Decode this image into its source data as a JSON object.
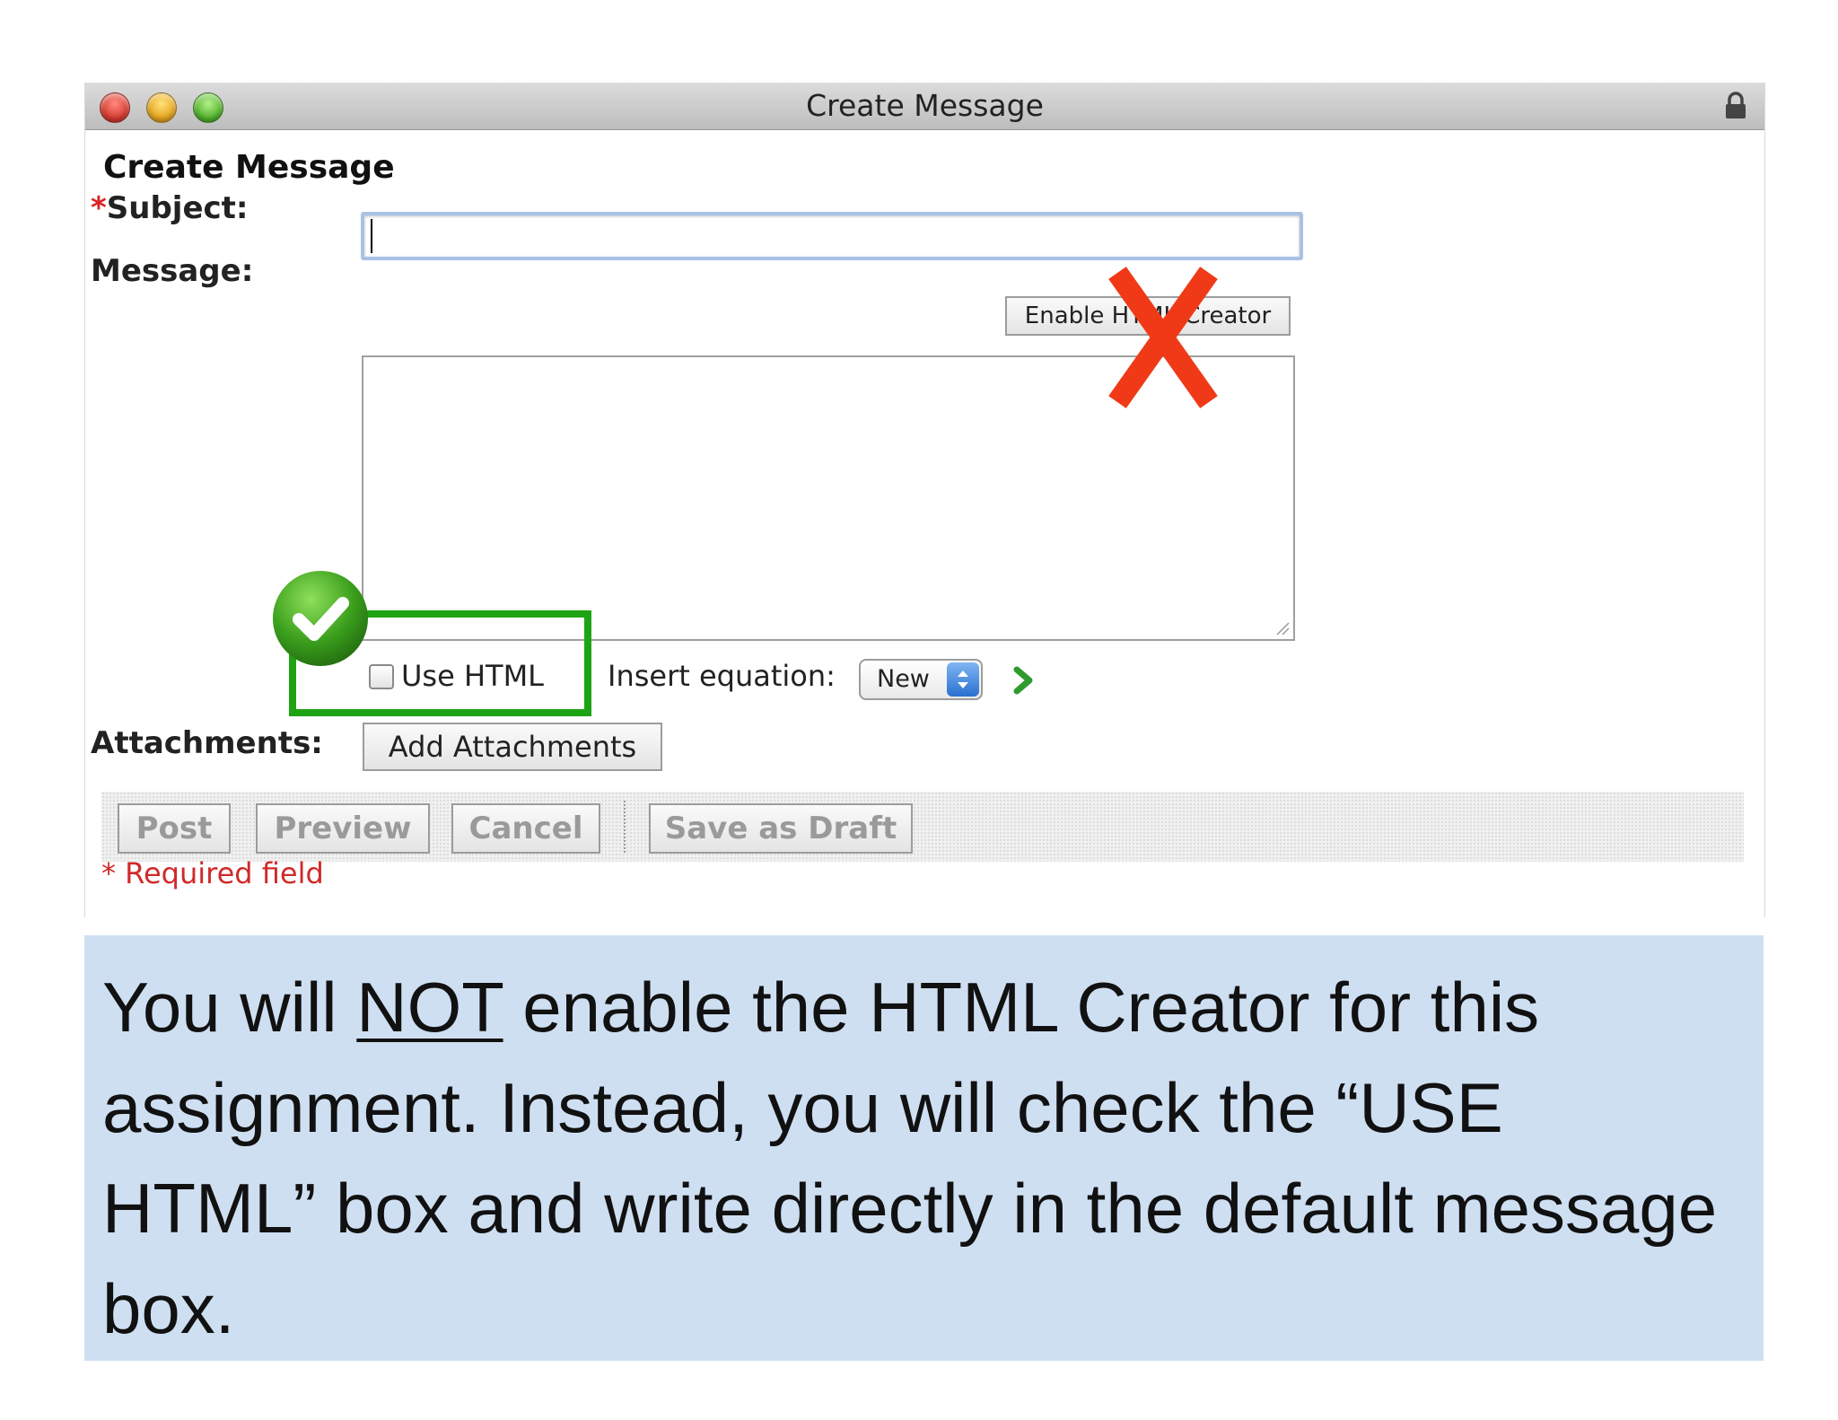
{
  "window": {
    "title": "Create Message"
  },
  "form": {
    "heading": "Create Message",
    "subject_label": "Subject:",
    "required_marker": "*",
    "subject_value": "",
    "message_label": "Message:",
    "enable_html_creator_label": "Enable HTML Creator",
    "message_value": "",
    "use_html_label": "Use HTML",
    "use_html_checked": false,
    "insert_equation_label": "Insert equation:",
    "equation_select_value": "New",
    "attachments_label": "Attachments:",
    "add_attachments_label": "Add Attachments"
  },
  "actions": {
    "post_label": "Post",
    "preview_label": "Preview",
    "cancel_label": "Cancel",
    "save_draft_label": "Save as Draft"
  },
  "footer": {
    "required_note": "* Required field"
  },
  "annotations": {
    "red_x": "X",
    "red_x_color": "#f03a17",
    "green_box_color": "#1ea314",
    "check_badge_icon": "check-badge-icon"
  },
  "caption": {
    "part1": "You will ",
    "emphasis": "NOT",
    "part2": " enable the HTML Creator for this assignment. Instead, you will check the “USE HTML” box and write directly in the default message box."
  }
}
